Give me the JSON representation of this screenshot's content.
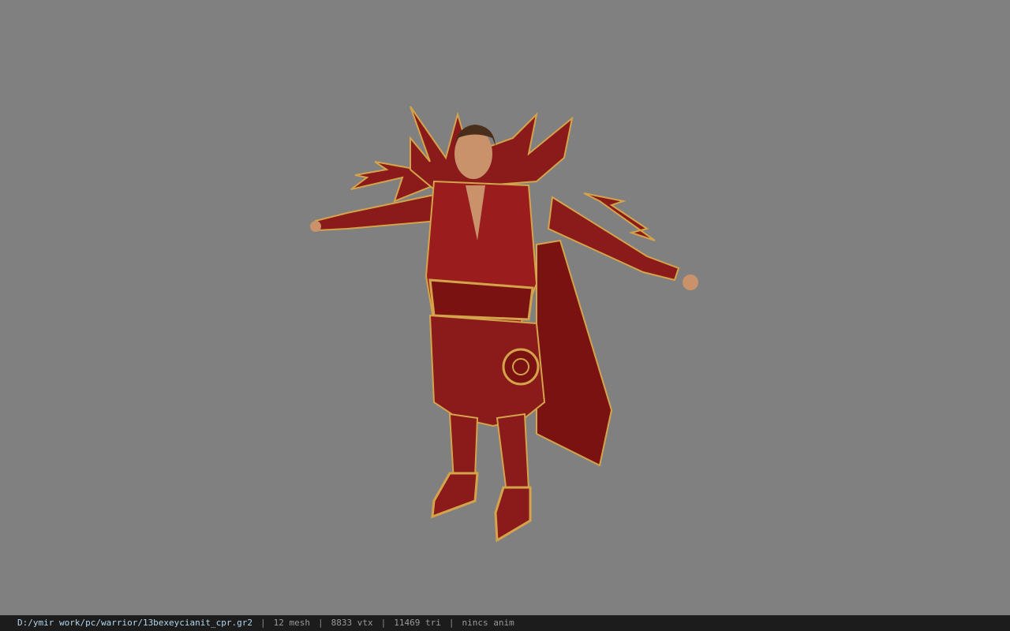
{
  "viewer": {
    "background_color": "#808080",
    "model_name": "warrior character model (T-pose)"
  },
  "status": {
    "file_path": "D:/ymir work/pc/warrior/13bexeycianit_cpr.gr2",
    "separator": "|",
    "mesh": "12 mesh",
    "vertices": "8833 vtx",
    "triangles": "11469 tri",
    "animation": "nincs anim"
  },
  "colors": {
    "armor_red": "#8b1a1a",
    "armor_gold": "#d4a44a",
    "skin": "#c9926a",
    "statusbar_bg": "#1c1c1c",
    "path_text": "#b4d6ee"
  }
}
